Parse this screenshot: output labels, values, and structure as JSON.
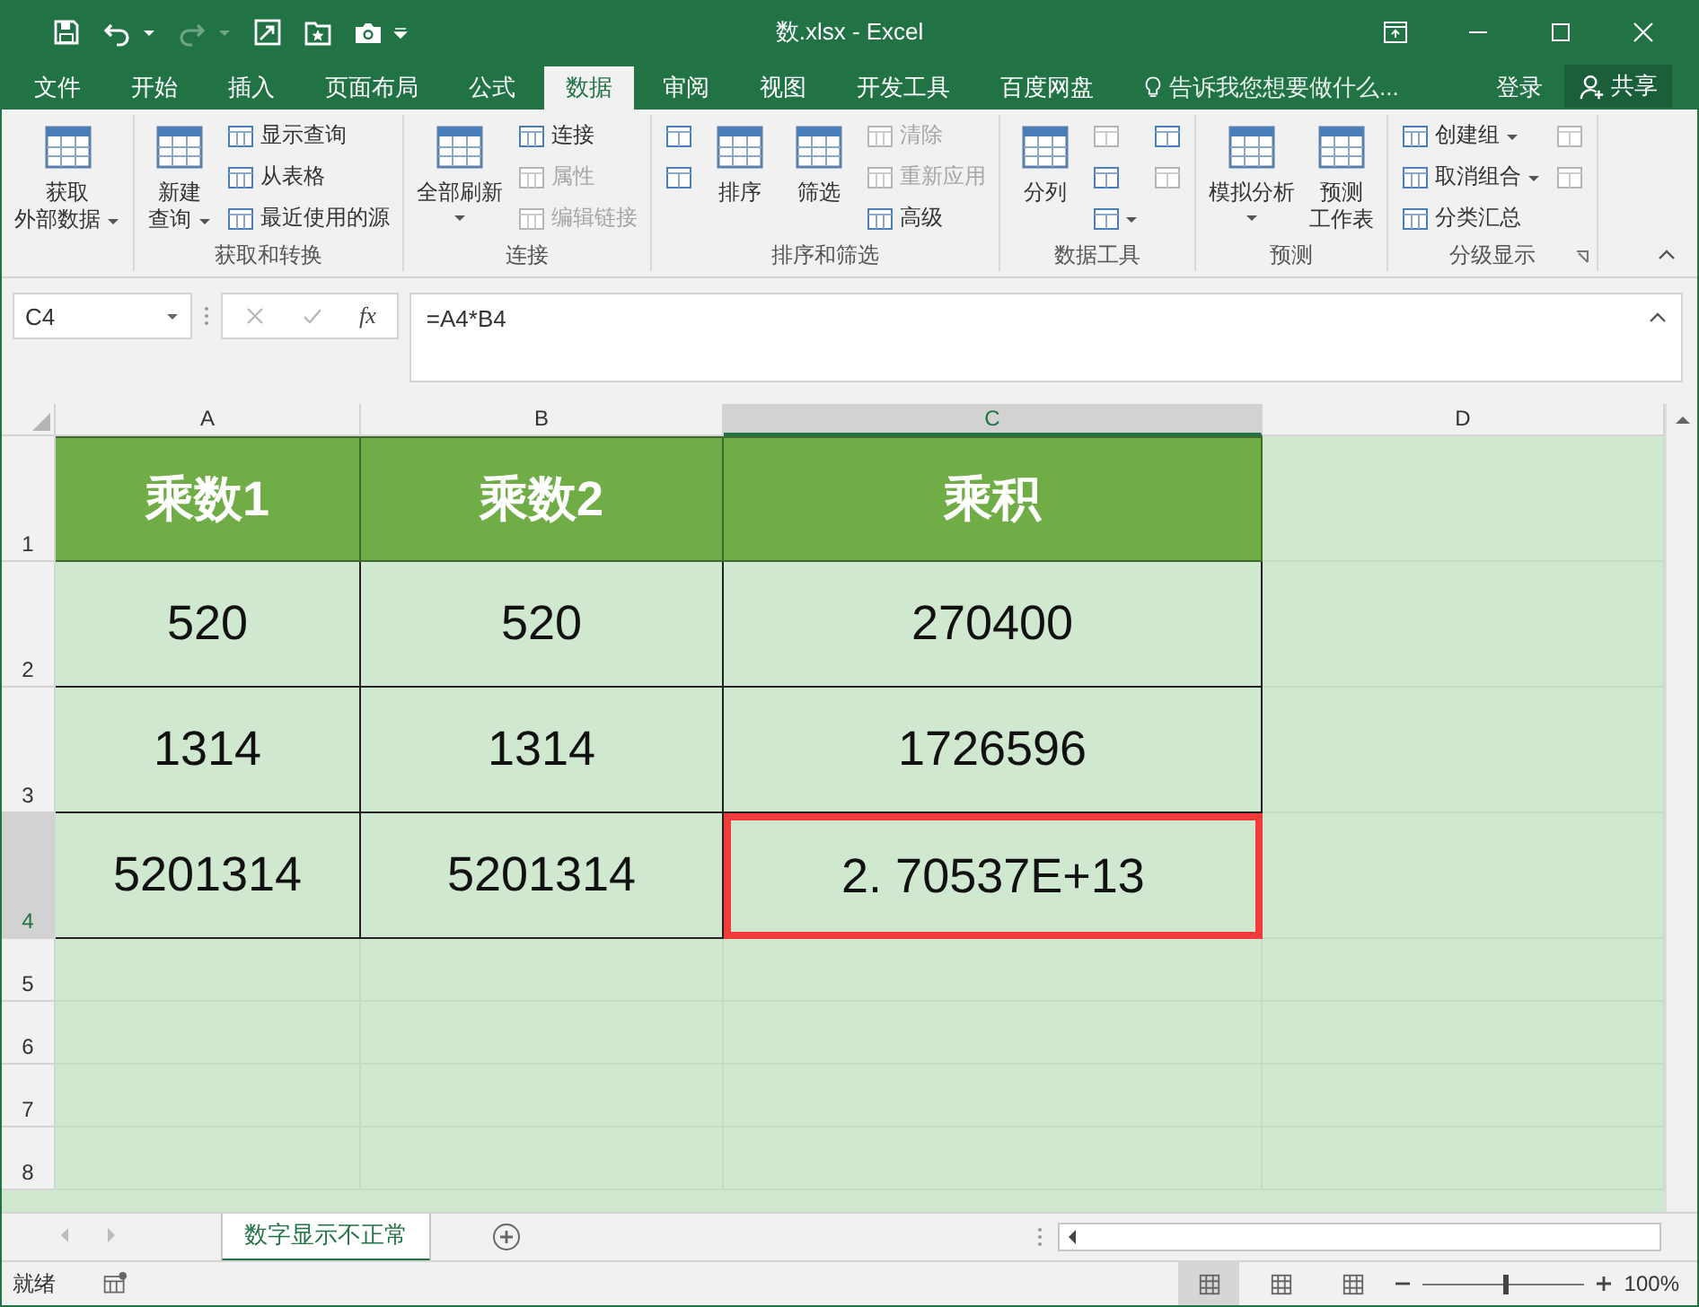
{
  "window": {
    "title": "数.xlsx - Excel"
  },
  "tabs": [
    {
      "label": "文件",
      "selected": false
    },
    {
      "label": "开始",
      "selected": false
    },
    {
      "label": "插入",
      "selected": false
    },
    {
      "label": "页面布局",
      "selected": false
    },
    {
      "label": "公式",
      "selected": false
    },
    {
      "label": "数据",
      "selected": true
    },
    {
      "label": "审阅",
      "selected": false
    },
    {
      "label": "视图",
      "selected": false
    },
    {
      "label": "开发工具",
      "selected": false
    },
    {
      "label": "百度网盘",
      "selected": false
    }
  ],
  "tell_me": {
    "placeholder": "告诉我您想要做什么..."
  },
  "account": {
    "sign_in": "登录",
    "share": "共享"
  },
  "ribbon": {
    "groups": [
      {
        "columns": [
          [
            {
              "kind": "large",
              "lines": [
                "获取",
                "外部数据"
              ],
              "dropdown": true,
              "disabled": false
            }
          ]
        ]
      },
      {
        "label": "获取和转换",
        "columns": [
          [
            {
              "kind": "large",
              "lines": [
                "新建",
                "查询"
              ],
              "dropdown": true,
              "disabled": false
            }
          ],
          [
            {
              "kind": "small",
              "lines": [
                "显示查询"
              ],
              "dropdown": false,
              "disabled": false
            },
            {
              "kind": "small",
              "lines": [
                "从表格"
              ],
              "dropdown": false,
              "disabled": false
            },
            {
              "kind": "small",
              "lines": [
                "最近使用的源"
              ],
              "dropdown": false,
              "disabled": false
            }
          ]
        ]
      },
      {
        "label": "连接",
        "columns": [
          [
            {
              "kind": "large",
              "lines": [
                "全部刷新"
              ],
              "dropdown": true,
              "disabled": false
            }
          ],
          [
            {
              "kind": "small",
              "lines": [
                "连接"
              ],
              "dropdown": false,
              "disabled": false
            },
            {
              "kind": "small",
              "lines": [
                "属性"
              ],
              "dropdown": false,
              "disabled": true
            },
            {
              "kind": "small",
              "lines": [
                "编辑链接"
              ],
              "dropdown": false,
              "disabled": true
            }
          ]
        ]
      },
      {
        "label": "排序和筛选",
        "columns": [
          [
            {
              "kind": "icon",
              "dropdown": false,
              "disabled": false
            },
            {
              "kind": "icon",
              "dropdown": false,
              "disabled": false
            }
          ],
          [
            {
              "kind": "large",
              "lines": [
                "排序"
              ],
              "dropdown": false,
              "disabled": false
            }
          ],
          [
            {
              "kind": "large",
              "lines": [
                "筛选"
              ],
              "dropdown": false,
              "disabled": false
            }
          ],
          [
            {
              "kind": "small",
              "lines": [
                "清除"
              ],
              "dropdown": false,
              "disabled": true
            },
            {
              "kind": "small",
              "lines": [
                "重新应用"
              ],
              "dropdown": false,
              "disabled": true
            },
            {
              "kind": "small",
              "lines": [
                "高级"
              ],
              "dropdown": false,
              "disabled": false
            }
          ]
        ]
      },
      {
        "label": "数据工具",
        "columns": [
          [
            {
              "kind": "large",
              "lines": [
                "分列"
              ],
              "dropdown": false,
              "disabled": false
            }
          ],
          [
            {
              "kind": "icon",
              "dropdown": false,
              "disabled": true
            },
            {
              "kind": "icon",
              "dropdown": false,
              "disabled": false
            },
            {
              "kind": "icon",
              "dropdown": true,
              "disabled": false
            }
          ],
          [
            {
              "kind": "icon",
              "dropdown": false,
              "disabled": false
            },
            {
              "kind": "icon",
              "dropdown": false,
              "disabled": true
            }
          ]
        ]
      },
      {
        "label": "预测",
        "columns": [
          [
            {
              "kind": "large",
              "lines": [
                "模拟分析"
              ],
              "dropdown": true,
              "disabled": false
            }
          ],
          [
            {
              "kind": "large",
              "lines": [
                "预测",
                "工作表"
              ],
              "dropdown": false,
              "disabled": false
            }
          ]
        ]
      },
      {
        "label": "分级显示",
        "launcher": true,
        "columns": [
          [
            {
              "kind": "small",
              "lines": [
                "创建组"
              ],
              "dropdown": true,
              "disabled": false
            },
            {
              "kind": "small",
              "lines": [
                "取消组合"
              ],
              "dropdown": true,
              "disabled": false
            },
            {
              "kind": "small",
              "lines": [
                "分类汇总"
              ],
              "dropdown": false,
              "disabled": false
            }
          ],
          [
            {
              "kind": "icon",
              "dropdown": false,
              "disabled": true
            },
            {
              "kind": "icon",
              "dropdown": false,
              "disabled": true
            }
          ]
        ]
      }
    ]
  },
  "formula_bar": {
    "name_box": "C4",
    "function_label": "fx",
    "formula": "=A4*B4"
  },
  "columns": [
    {
      "label": "A",
      "selected": false
    },
    {
      "label": "B",
      "selected": false
    },
    {
      "label": "C",
      "selected": true
    },
    {
      "label": "D",
      "selected": false
    }
  ],
  "rows": [
    {
      "number": "1",
      "selected": false,
      "cells": [
        {
          "kind": "header",
          "text": "乘数1",
          "selected": false
        },
        {
          "kind": "header",
          "text": "乘数2",
          "selected": false
        },
        {
          "kind": "header",
          "text": "乘积",
          "selected": false
        }
      ]
    },
    {
      "number": "2",
      "selected": false,
      "cells": [
        {
          "kind": "data",
          "text": "520",
          "selected": false
        },
        {
          "kind": "data",
          "text": "520",
          "selected": false
        },
        {
          "kind": "data",
          "text": "270400",
          "selected": false
        }
      ]
    },
    {
      "number": "3",
      "selected": false,
      "cells": [
        {
          "kind": "data",
          "text": "1314",
          "selected": false
        },
        {
          "kind": "data",
          "text": "1314",
          "selected": false
        },
        {
          "kind": "data",
          "text": "1726596",
          "selected": false
        }
      ]
    },
    {
      "number": "4",
      "selected": true,
      "cells": [
        {
          "kind": "data",
          "text": "5201314",
          "selected": false
        },
        {
          "kind": "data",
          "text": "5201314",
          "selected": false
        },
        {
          "kind": "data",
          "text": "2. 70537E+13",
          "selected": true
        }
      ]
    },
    {
      "number": "5",
      "selected": false,
      "cells": []
    },
    {
      "number": "6",
      "selected": false,
      "cells": []
    },
    {
      "number": "7",
      "selected": false,
      "cells": []
    },
    {
      "number": "8",
      "selected": false,
      "cells": []
    }
  ],
  "sheets": [
    {
      "label": "数字显示不正常",
      "selected": true
    }
  ],
  "status_bar": {
    "status": "就绪",
    "views": [
      {
        "selected": true
      },
      {
        "selected": false
      },
      {
        "selected": false
      }
    ],
    "zoom": {
      "level": 0.5,
      "reading": "100%"
    }
  }
}
